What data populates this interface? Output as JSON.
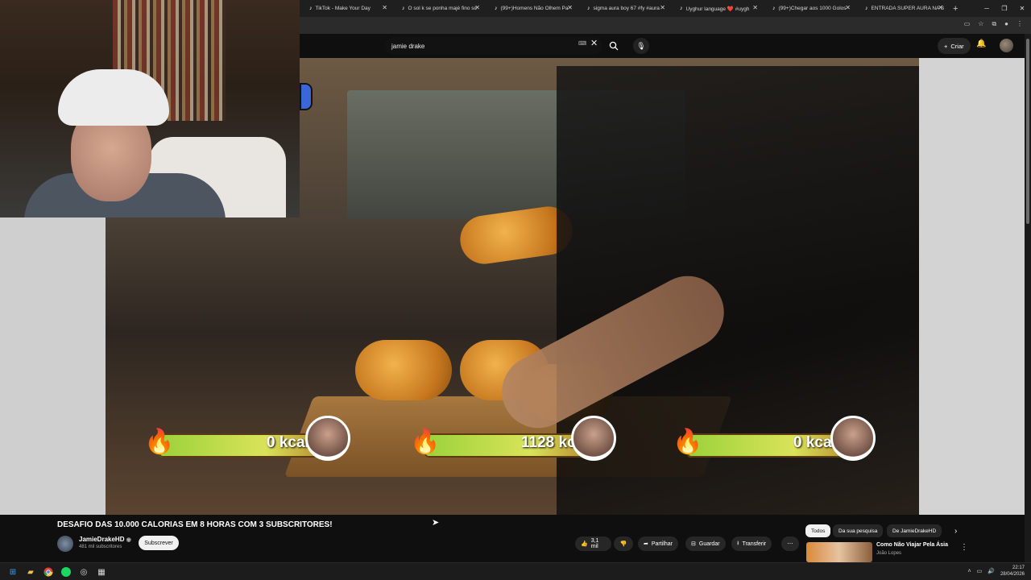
{
  "browser": {
    "tabs": [
      {
        "label": "TikTok - Make Your Day"
      },
      {
        "label": "O sol k se ponha majé fino sc"
      },
      {
        "label": "(99+)Homens Não Olhem Pa"
      },
      {
        "label": "sigma aura boy 67 #fy #aura"
      },
      {
        "label": "Uyghur language ❤️ #uygh"
      },
      {
        "label": "(99+)Chegar aos 1000 Golos"
      },
      {
        "label": "ENTRADA SUPER AURA NA S"
      }
    ],
    "new_tab": "+"
  },
  "youtube": {
    "search_value": "jamie drake",
    "create_label": "Criar",
    "video": {
      "bars": [
        {
          "kcal": "0 kcal",
          "fill": 0.0
        },
        {
          "kcal": "1128 kcal",
          "fill": 0.1
        },
        {
          "kcal": "0 kcal",
          "fill": 0.0
        }
      ]
    },
    "title": "DESAFIO DAS 10.000 CALORIAS EM 8 HORAS COM 3 SUBSCRITORES!",
    "channel": {
      "name": "JamieDrakeHD",
      "subs": "481 mil subscritores"
    },
    "subscribe_label": "Subscrever",
    "actions": {
      "likes": "3,1 mil",
      "share": "Partilhar",
      "save": "Guardar",
      "download": "Transferir"
    },
    "chips": [
      "Todos",
      "Da sua pesquisa",
      "De JamieDrakeHD"
    ],
    "recommended": {
      "title": "Como Não Viajar Pela Ásia",
      "channel": "João Lopes"
    }
  },
  "taskbar": {
    "time": "22:17",
    "date": "28/04/2026"
  },
  "icons": [
    "windows-icon",
    "folder-icon",
    "chrome-icon",
    "spotify-icon",
    "obs-icon",
    "calculator-icon"
  ]
}
